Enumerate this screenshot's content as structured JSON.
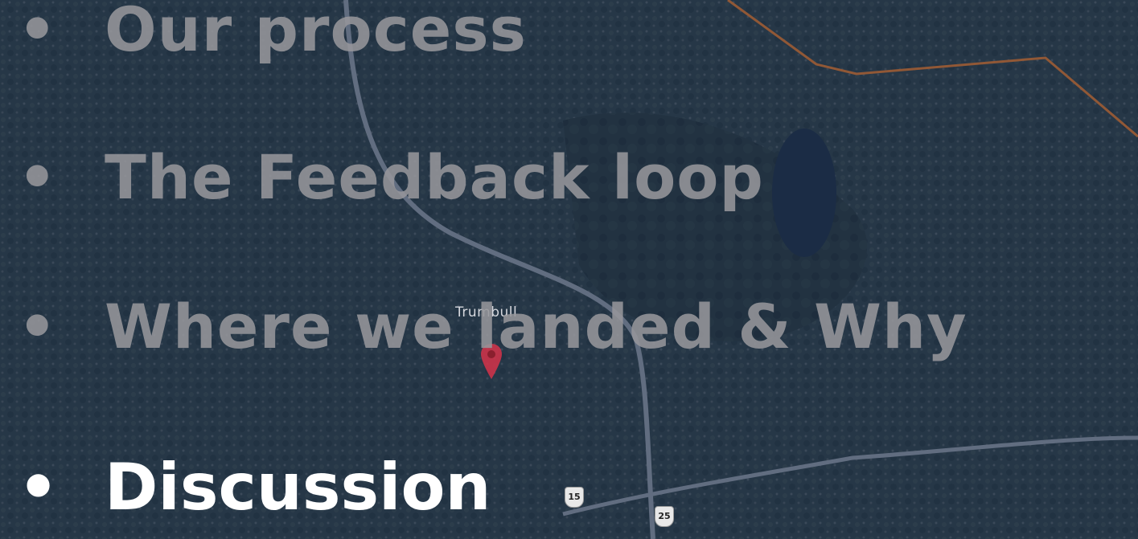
{
  "map": {
    "place_label": "Trumbull",
    "route_shields": [
      "15",
      "25"
    ]
  },
  "bullets": [
    {
      "marker": "•",
      "text": "Our process",
      "state": "dimmed"
    },
    {
      "marker": "•",
      "text": "The Feedback loop",
      "state": "dimmed"
    },
    {
      "marker": "•",
      "text": "Where we landed & Why",
      "state": "dimmed"
    },
    {
      "marker": "•",
      "text": "Discussion",
      "state": "active"
    }
  ],
  "colors": {
    "overlay": "#1c2e58",
    "boundary_line": "#f07a1a",
    "dim_text": "#96969b",
    "active_text": "#ffffff",
    "pin": "#d6334a"
  }
}
